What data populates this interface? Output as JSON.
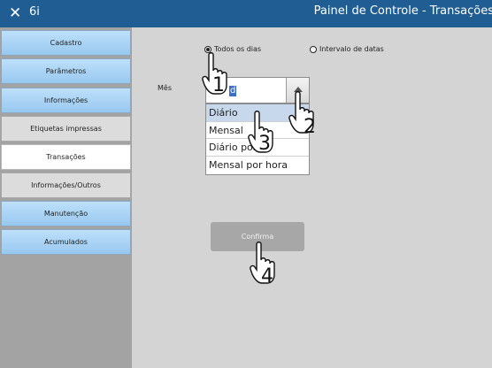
{
  "titlebar": {
    "close_glyph": "✕",
    "app_name": "6i",
    "title": "Painel de Controle - Transações"
  },
  "sidebar": {
    "items": [
      {
        "label": "Cadastro",
        "style": "blue"
      },
      {
        "label": "Parâmetros",
        "style": "blue"
      },
      {
        "label": "Informações",
        "style": "blue"
      },
      {
        "label": "Etiquetas impressas",
        "style": "gray"
      },
      {
        "label": "Transações",
        "style": "white",
        "active": true
      },
      {
        "label": "Informações/Outros",
        "style": "gray"
      },
      {
        "label": "Manutenção",
        "style": "blue"
      },
      {
        "label": "Acumulados",
        "style": "blue"
      }
    ]
  },
  "filters": {
    "radio_all_days": {
      "label": "Todos os dias",
      "checked": true
    },
    "radio_date_range": {
      "label": "Intervalo de datas",
      "checked": false
    }
  },
  "month": {
    "label": "Mês",
    "selected_value": "d",
    "options": [
      "Diário",
      "Mensal",
      "Diário por",
      "Mensal por hora"
    ],
    "highlighted_index": 0
  },
  "confirm_label": "Confirma",
  "steps": [
    "1",
    "2",
    "3",
    "4"
  ],
  "icons": {
    "close": "close-icon",
    "pointer": "hand-pointer-icon",
    "dropdown": "chevron-up-icon"
  }
}
